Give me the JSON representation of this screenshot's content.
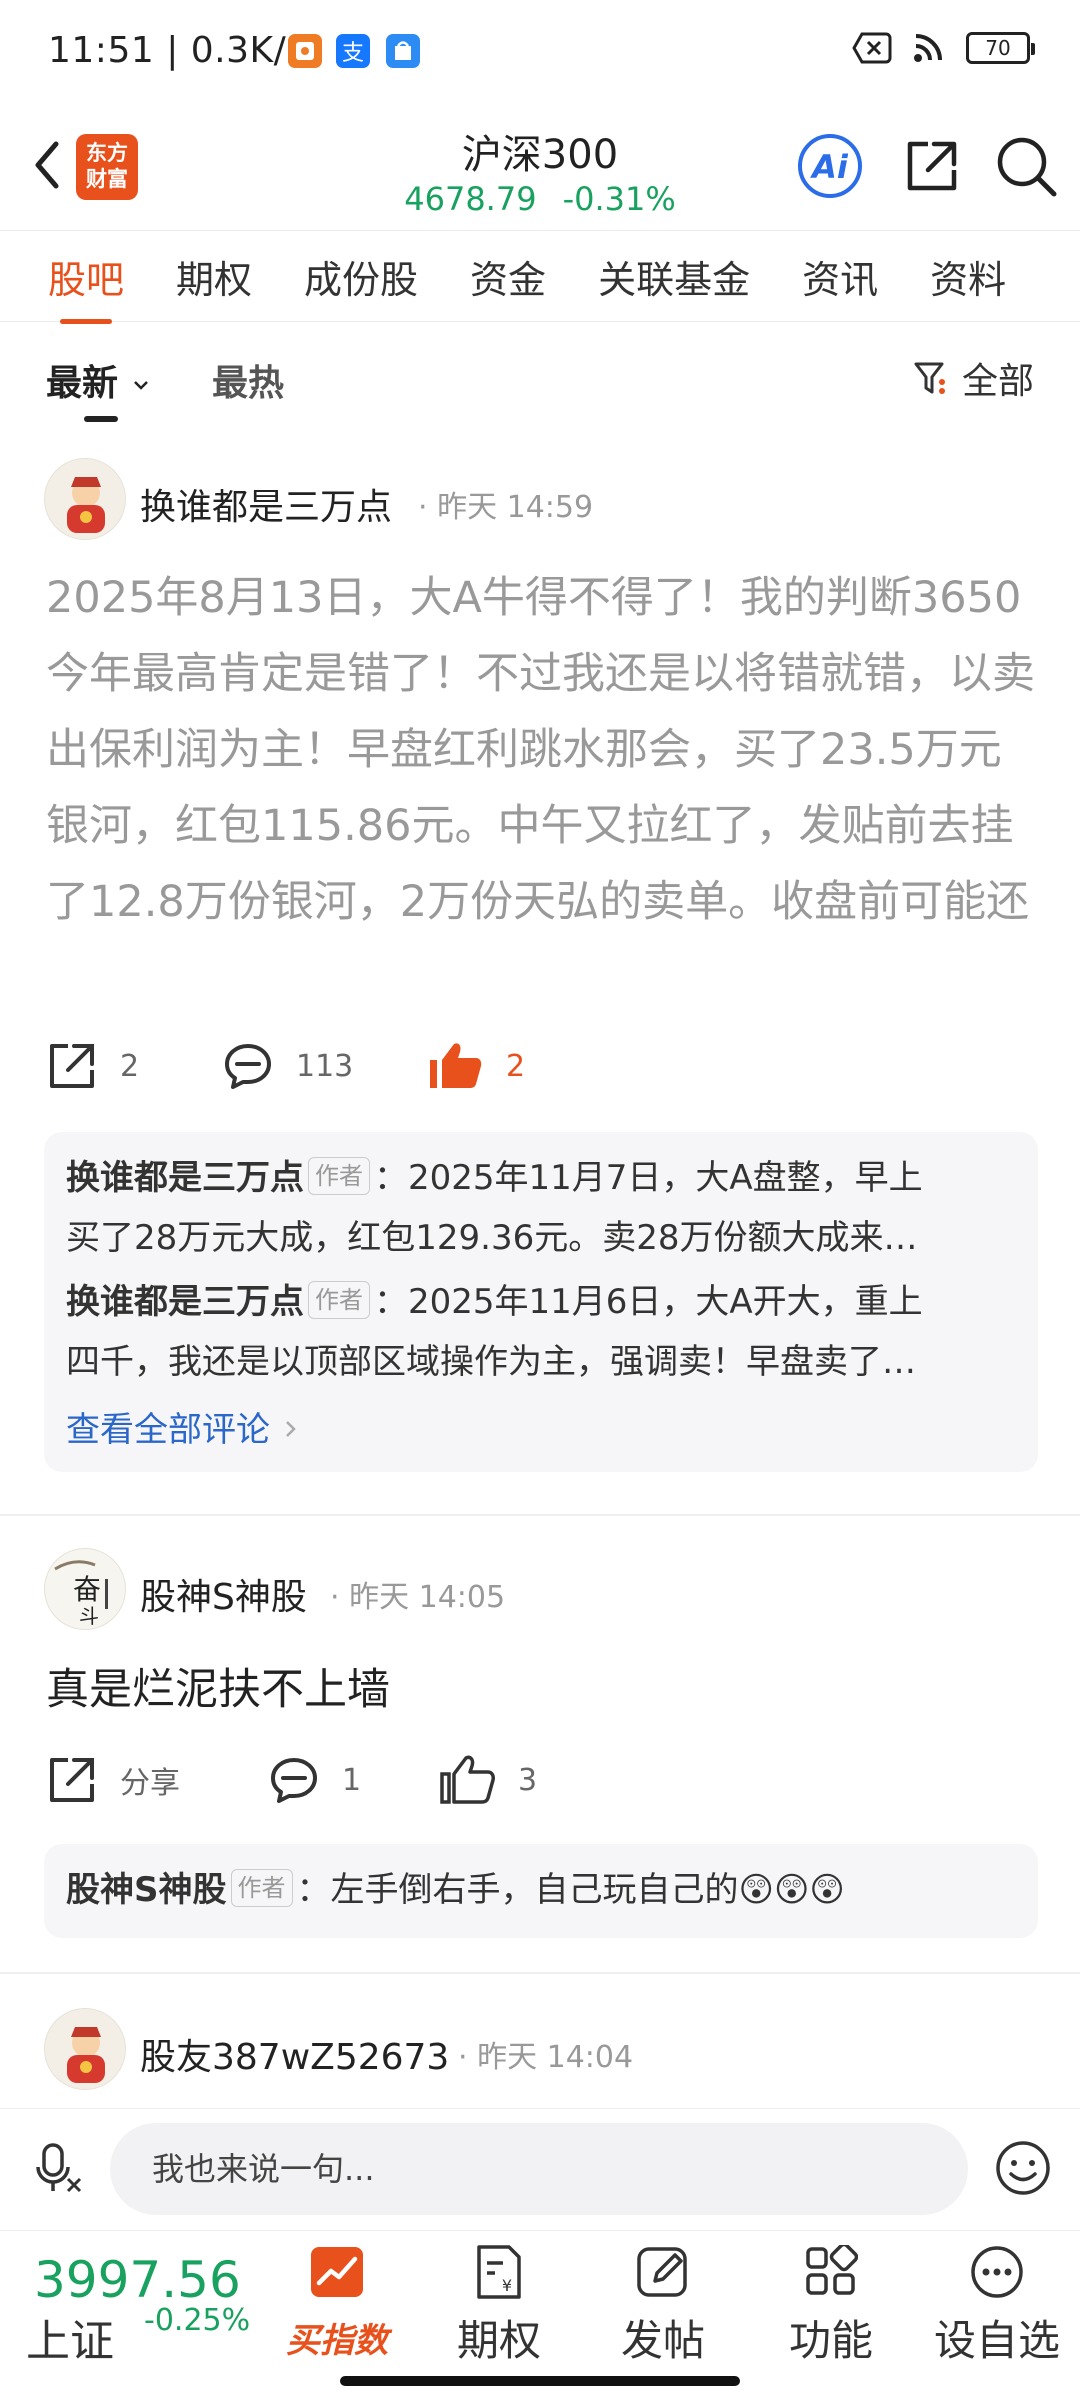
{
  "status_bar": {
    "time": "11:51 | 0.3K/s",
    "battery": "70",
    "app_icons": [
      {
        "name": "red-envelope-app-icon",
        "color": "#f07b25"
      },
      {
        "name": "alipay-app-icon",
        "color": "#1677ff"
      },
      {
        "name": "taobao-app-icon",
        "color": "#2c8cf4"
      }
    ]
  },
  "header": {
    "logo_line1": "东方",
    "logo_line2": "财富",
    "title": "沪深300",
    "price": "4678.79",
    "change": "-0.31%"
  },
  "tabs": [
    "股吧",
    "期权",
    "成份股",
    "资金",
    "关联基金",
    "资讯",
    "资料"
  ],
  "sort": {
    "latest": "最新",
    "hottest": "最热",
    "filter": "全部"
  },
  "posts": [
    {
      "author": "换谁都是三万点",
      "time": "昨天 14:59",
      "content": "2025年8月13日，大A牛得不得了！我的判断3650今年最高肯定是错了！不过我还是以将错就错，以卖出保利润为主！早盘红利跳水那会，买了23.5万元银河，红包115.86元。中午又拉红了，发贴前去挂了12.8万份银河，2万份天弘的卖单。收盘前可能还会卖！今天要不是消了红包…",
      "shares": "2",
      "comments": "113",
      "likes": "2",
      "replies": [
        {
          "name": "换谁都是三万点",
          "badge": "作者",
          "text": "：2025年11月7日，大A盘整，早上买了28万元大成，红包129.36元。卖28万份额大成来…"
        },
        {
          "name": "换谁都是三万点",
          "badge": "作者",
          "text": "：2025年11月6日，大A开大，重上四千，我还是以顶部区域操作为主，强调卖！早盘卖了…"
        }
      ],
      "view_all": "查看全部评论"
    },
    {
      "author": "股神S神股",
      "time": "昨天 14:05",
      "content": "真是烂泥扶不上墙",
      "shares": "分享",
      "comments": "1",
      "likes": "3",
      "replies": [
        {
          "name": "股神S神股",
          "badge": "作者",
          "text": "：左手倒右手，自己玩自己的😲😲😲"
        }
      ]
    },
    {
      "author": "股友387wZ52673",
      "time": "昨天 14:04"
    }
  ],
  "input": {
    "placeholder": "我也来说一句..."
  },
  "bottom_nav": {
    "index_value": "3997.56",
    "index_name": "上证",
    "index_change": "-0.25%",
    "items": [
      "买指数",
      "期权",
      "发帖",
      "功能",
      "设自选"
    ]
  },
  "colors": {
    "accent": "#e8501c",
    "down": "#19a15f",
    "link": "#2a67c9"
  }
}
